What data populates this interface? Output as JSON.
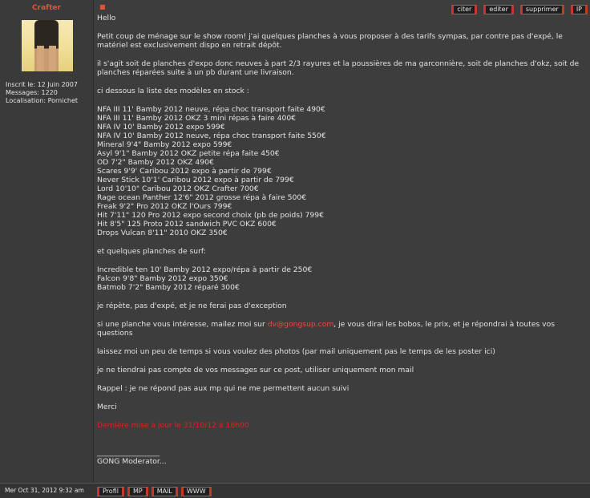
{
  "author": {
    "name": "Crafter"
  },
  "profile": {
    "joined_label": "Inscrit le:",
    "joined_value": "12 Juin 2007",
    "messages_label": "Messages:",
    "messages_value": "1220",
    "location_label": "Localisation:",
    "location_value": "Pornichet"
  },
  "toolbar": {
    "quote": "citer",
    "edit": "editer",
    "delete": "supprimer",
    "ip": "IP"
  },
  "post": {
    "greeting": "Hello",
    "intro": "Petit coup de ménage sur le show room! j'ai quelques planches à vous proposer à des tarifs sympas, par contre pas d'expé, le matériel est exclusivement dispo en retrait dépôt.",
    "details": "il s'agit soit de planches d'expo donc neuves à part 2/3 rayures et la poussières de ma garconnière, soit de planches d'okz, soit de planches réparées suite à un pb durant une livraison.",
    "list_intro": "ci dessous la liste des modèles en stock :",
    "boards": [
      "NFA III 11' Bamby 2012 neuve, répa choc transport faite 490€",
      "NFA III 11' Bamby 2012 OKZ 3 mini répas à faire 400€",
      "NFA IV 10' Bamby 2012 expo 599€",
      "NFA IV 10' Bamby 2012 neuve, répa choc transport faite 550€",
      "Mineral 9'4\" Bamby 2012 expo 599€",
      "Asyl 9'1\" Bamby 2012 OKZ petite répa faite 450€",
      "OD 7'2\" Bamby 2012 OKZ 490€",
      "Scares 9'9' Caribou 2012 expo à partir de 799€",
      "Never Stick 10'1' Caribou 2012 expo à partir de 799€",
      "Lord 10'10\" Caribou 2012 OKZ Crafter 700€",
      "Rage ocean Panther 12'6\" 2012 grosse répa à faire 500€",
      "Freak 9'2\" Pro 2012 OKZ l'Ours 799€",
      "Hit 7'11\" 120 Pro 2012 expo second choix (pb de poids) 799€",
      "Hit 8'5\" 125 Proto 2012 sandwich PVC OKZ 600€",
      "Drops Vulcan 8'11\" 2010 OKZ 350€"
    ],
    "surf_intro": "et quelques planches de surf:",
    "surf_boards": [
      "Incredible ten 10' Bamby 2012 expo/répa à partir de 250€",
      "Falcon 9'8\" Bamby 2012 expo 350€",
      "Batmob 7'2\" Bamby 2012 réparé 300€"
    ],
    "repeat": "je répète, pas d'expé, et je ne ferai pas d'exception",
    "contact_before": "si une planche vous intéresse, mailez moi sur ",
    "contact_email": "dv@gongsup.com",
    "contact_after": ", je vous dirai les bobos, le prix, et je répondrai à toutes vos questions",
    "photos": "laissez moi un peu de temps si vous voulez des photos (par mail uniquement pas le temps de les poster ici)",
    "no_comments": "je ne tiendrai pas compte de vos messages sur ce post, utiliser uniquement mon mail",
    "reminder": "Rappel : je ne répond pas aux mp qui ne me permettent aucun suivi",
    "thanks": "Merci",
    "last_update": "Dernière mise à jour le 31/10/12 à 18h00",
    "signature_rule": "_________________",
    "signature": "GONG Moderator..."
  },
  "footer": {
    "date": "Mer Oct 31, 2012 9:32 am",
    "profile": "Profil",
    "pm": "MP",
    "mail": "MAIL",
    "www": "WWW"
  },
  "colors": {
    "accent": "#e0533b",
    "update_red": "#d9261c",
    "background": "#3d3d3d"
  },
  "icons": {
    "post": "post-marker-icon"
  }
}
